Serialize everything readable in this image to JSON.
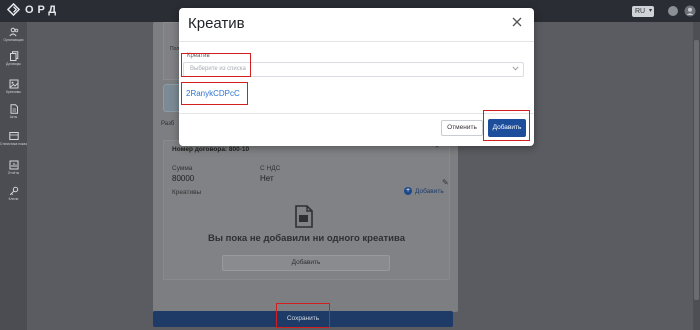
{
  "app": {
    "logo_text": "ОРД",
    "language": "RU"
  },
  "sidebar": {
    "items": [
      {
        "label": "Организации",
        "icon": "users-icon"
      },
      {
        "label": "Договоры",
        "icon": "documents-icon"
      },
      {
        "label": "Креативы",
        "icon": "image-icon"
      },
      {
        "label": "Акты",
        "icon": "file-icon"
      },
      {
        "label": "Статистика показов",
        "icon": "stats-icon"
      },
      {
        "label": "Отчёты",
        "icon": "report-icon"
      },
      {
        "label": "Ключи",
        "icon": "key-icon"
      }
    ]
  },
  "background": {
    "side_label": "Разб",
    "contract_title": "Номер договора: 800-10",
    "sum_label": "Сумма",
    "sum_value": "80000",
    "vat_label": "С НДС",
    "vat_value": "Нет",
    "creatives_label": "Креативы",
    "add_link": "Добавить",
    "empty_text": "Вы пока не добавили ни одного креатива",
    "empty_button": "Добавить",
    "save_button": "Сохранить",
    "tiny_label": "Пол"
  },
  "modal": {
    "title": "Креатив",
    "select_label": "Креатив",
    "select_placeholder": "Выберите из списка",
    "creative_id": "2RanykCDPcC",
    "cancel": "Отменить",
    "add": "Добавить"
  },
  "colors": {
    "accent": "#1d4e9c",
    "link": "#2c75d1",
    "highlight": "#d11f1f"
  }
}
